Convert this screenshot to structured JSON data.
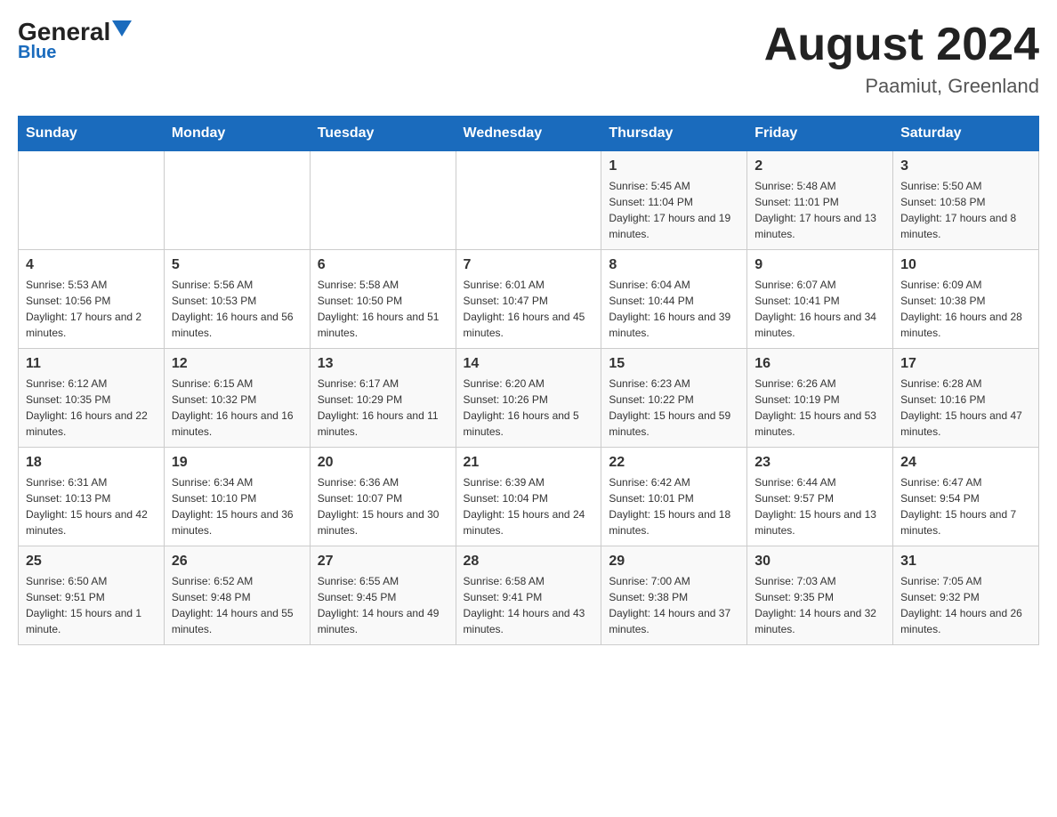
{
  "header": {
    "logo_text": "General",
    "logo_blue": "Blue",
    "month_title": "August 2024",
    "location": "Paamiut, Greenland"
  },
  "days_of_week": [
    "Sunday",
    "Monday",
    "Tuesday",
    "Wednesday",
    "Thursday",
    "Friday",
    "Saturday"
  ],
  "weeks": [
    [
      {
        "day": "",
        "info": ""
      },
      {
        "day": "",
        "info": ""
      },
      {
        "day": "",
        "info": ""
      },
      {
        "day": "",
        "info": ""
      },
      {
        "day": "1",
        "info": "Sunrise: 5:45 AM\nSunset: 11:04 PM\nDaylight: 17 hours and 19 minutes."
      },
      {
        "day": "2",
        "info": "Sunrise: 5:48 AM\nSunset: 11:01 PM\nDaylight: 17 hours and 13 minutes."
      },
      {
        "day": "3",
        "info": "Sunrise: 5:50 AM\nSunset: 10:58 PM\nDaylight: 17 hours and 8 minutes."
      }
    ],
    [
      {
        "day": "4",
        "info": "Sunrise: 5:53 AM\nSunset: 10:56 PM\nDaylight: 17 hours and 2 minutes."
      },
      {
        "day": "5",
        "info": "Sunrise: 5:56 AM\nSunset: 10:53 PM\nDaylight: 16 hours and 56 minutes."
      },
      {
        "day": "6",
        "info": "Sunrise: 5:58 AM\nSunset: 10:50 PM\nDaylight: 16 hours and 51 minutes."
      },
      {
        "day": "7",
        "info": "Sunrise: 6:01 AM\nSunset: 10:47 PM\nDaylight: 16 hours and 45 minutes."
      },
      {
        "day": "8",
        "info": "Sunrise: 6:04 AM\nSunset: 10:44 PM\nDaylight: 16 hours and 39 minutes."
      },
      {
        "day": "9",
        "info": "Sunrise: 6:07 AM\nSunset: 10:41 PM\nDaylight: 16 hours and 34 minutes."
      },
      {
        "day": "10",
        "info": "Sunrise: 6:09 AM\nSunset: 10:38 PM\nDaylight: 16 hours and 28 minutes."
      }
    ],
    [
      {
        "day": "11",
        "info": "Sunrise: 6:12 AM\nSunset: 10:35 PM\nDaylight: 16 hours and 22 minutes."
      },
      {
        "day": "12",
        "info": "Sunrise: 6:15 AM\nSunset: 10:32 PM\nDaylight: 16 hours and 16 minutes."
      },
      {
        "day": "13",
        "info": "Sunrise: 6:17 AM\nSunset: 10:29 PM\nDaylight: 16 hours and 11 minutes."
      },
      {
        "day": "14",
        "info": "Sunrise: 6:20 AM\nSunset: 10:26 PM\nDaylight: 16 hours and 5 minutes."
      },
      {
        "day": "15",
        "info": "Sunrise: 6:23 AM\nSunset: 10:22 PM\nDaylight: 15 hours and 59 minutes."
      },
      {
        "day": "16",
        "info": "Sunrise: 6:26 AM\nSunset: 10:19 PM\nDaylight: 15 hours and 53 minutes."
      },
      {
        "day": "17",
        "info": "Sunrise: 6:28 AM\nSunset: 10:16 PM\nDaylight: 15 hours and 47 minutes."
      }
    ],
    [
      {
        "day": "18",
        "info": "Sunrise: 6:31 AM\nSunset: 10:13 PM\nDaylight: 15 hours and 42 minutes."
      },
      {
        "day": "19",
        "info": "Sunrise: 6:34 AM\nSunset: 10:10 PM\nDaylight: 15 hours and 36 minutes."
      },
      {
        "day": "20",
        "info": "Sunrise: 6:36 AM\nSunset: 10:07 PM\nDaylight: 15 hours and 30 minutes."
      },
      {
        "day": "21",
        "info": "Sunrise: 6:39 AM\nSunset: 10:04 PM\nDaylight: 15 hours and 24 minutes."
      },
      {
        "day": "22",
        "info": "Sunrise: 6:42 AM\nSunset: 10:01 PM\nDaylight: 15 hours and 18 minutes."
      },
      {
        "day": "23",
        "info": "Sunrise: 6:44 AM\nSunset: 9:57 PM\nDaylight: 15 hours and 13 minutes."
      },
      {
        "day": "24",
        "info": "Sunrise: 6:47 AM\nSunset: 9:54 PM\nDaylight: 15 hours and 7 minutes."
      }
    ],
    [
      {
        "day": "25",
        "info": "Sunrise: 6:50 AM\nSunset: 9:51 PM\nDaylight: 15 hours and 1 minute."
      },
      {
        "day": "26",
        "info": "Sunrise: 6:52 AM\nSunset: 9:48 PM\nDaylight: 14 hours and 55 minutes."
      },
      {
        "day": "27",
        "info": "Sunrise: 6:55 AM\nSunset: 9:45 PM\nDaylight: 14 hours and 49 minutes."
      },
      {
        "day": "28",
        "info": "Sunrise: 6:58 AM\nSunset: 9:41 PM\nDaylight: 14 hours and 43 minutes."
      },
      {
        "day": "29",
        "info": "Sunrise: 7:00 AM\nSunset: 9:38 PM\nDaylight: 14 hours and 37 minutes."
      },
      {
        "day": "30",
        "info": "Sunrise: 7:03 AM\nSunset: 9:35 PM\nDaylight: 14 hours and 32 minutes."
      },
      {
        "day": "31",
        "info": "Sunrise: 7:05 AM\nSunset: 9:32 PM\nDaylight: 14 hours and 26 minutes."
      }
    ]
  ]
}
